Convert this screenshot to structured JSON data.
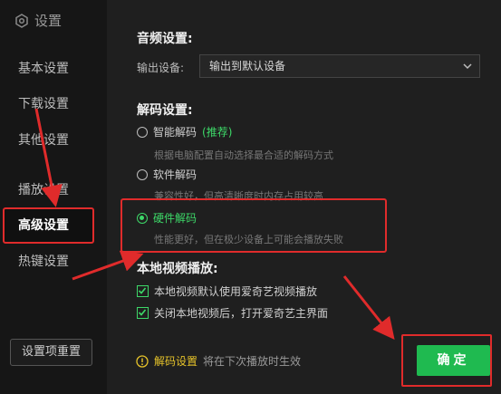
{
  "sidebar": {
    "title": "设置",
    "items": [
      {
        "label": "基本设置"
      },
      {
        "label": "下载设置"
      },
      {
        "label": "其他设置"
      },
      {
        "label": "播放设置"
      },
      {
        "label": "高级设置",
        "active": true
      },
      {
        "label": "热键设置"
      }
    ],
    "reset_label": "设置项重置"
  },
  "audio": {
    "title": "音频设置:",
    "output_label": "输出设备:",
    "output_value": "输出到默认设备"
  },
  "decode": {
    "title": "解码设置:",
    "options": [
      {
        "label": "智能解码",
        "tag": "(推荐)",
        "desc": "根据电脑配置自动选择最合适的解码方式",
        "checked": false
      },
      {
        "label": "软件解码",
        "desc": "兼容性好，但高清晰度时内存占用较高",
        "checked": false
      },
      {
        "label": "硬件解码",
        "desc": "性能更好，但在极少设备上可能会播放失败",
        "checked": true
      }
    ]
  },
  "local_video": {
    "title": "本地视频播放:",
    "options": [
      {
        "label": "本地视频默认使用爱奇艺视频播放",
        "checked": true
      },
      {
        "label": "关闭本地视频后，打开爱奇艺主界面",
        "checked": true
      }
    ]
  },
  "notice": {
    "key": "解码设置",
    "text": "将在下次播放时生效"
  },
  "ok_label": "确定",
  "colors": {
    "accent": "#3dd868",
    "button": "#1fba50",
    "annotation": "#e02b2b",
    "warning": "#e6c32a"
  },
  "icons": {
    "brand": "gear-icon",
    "select": "chevron-down-icon",
    "notice": "warning-icon"
  }
}
